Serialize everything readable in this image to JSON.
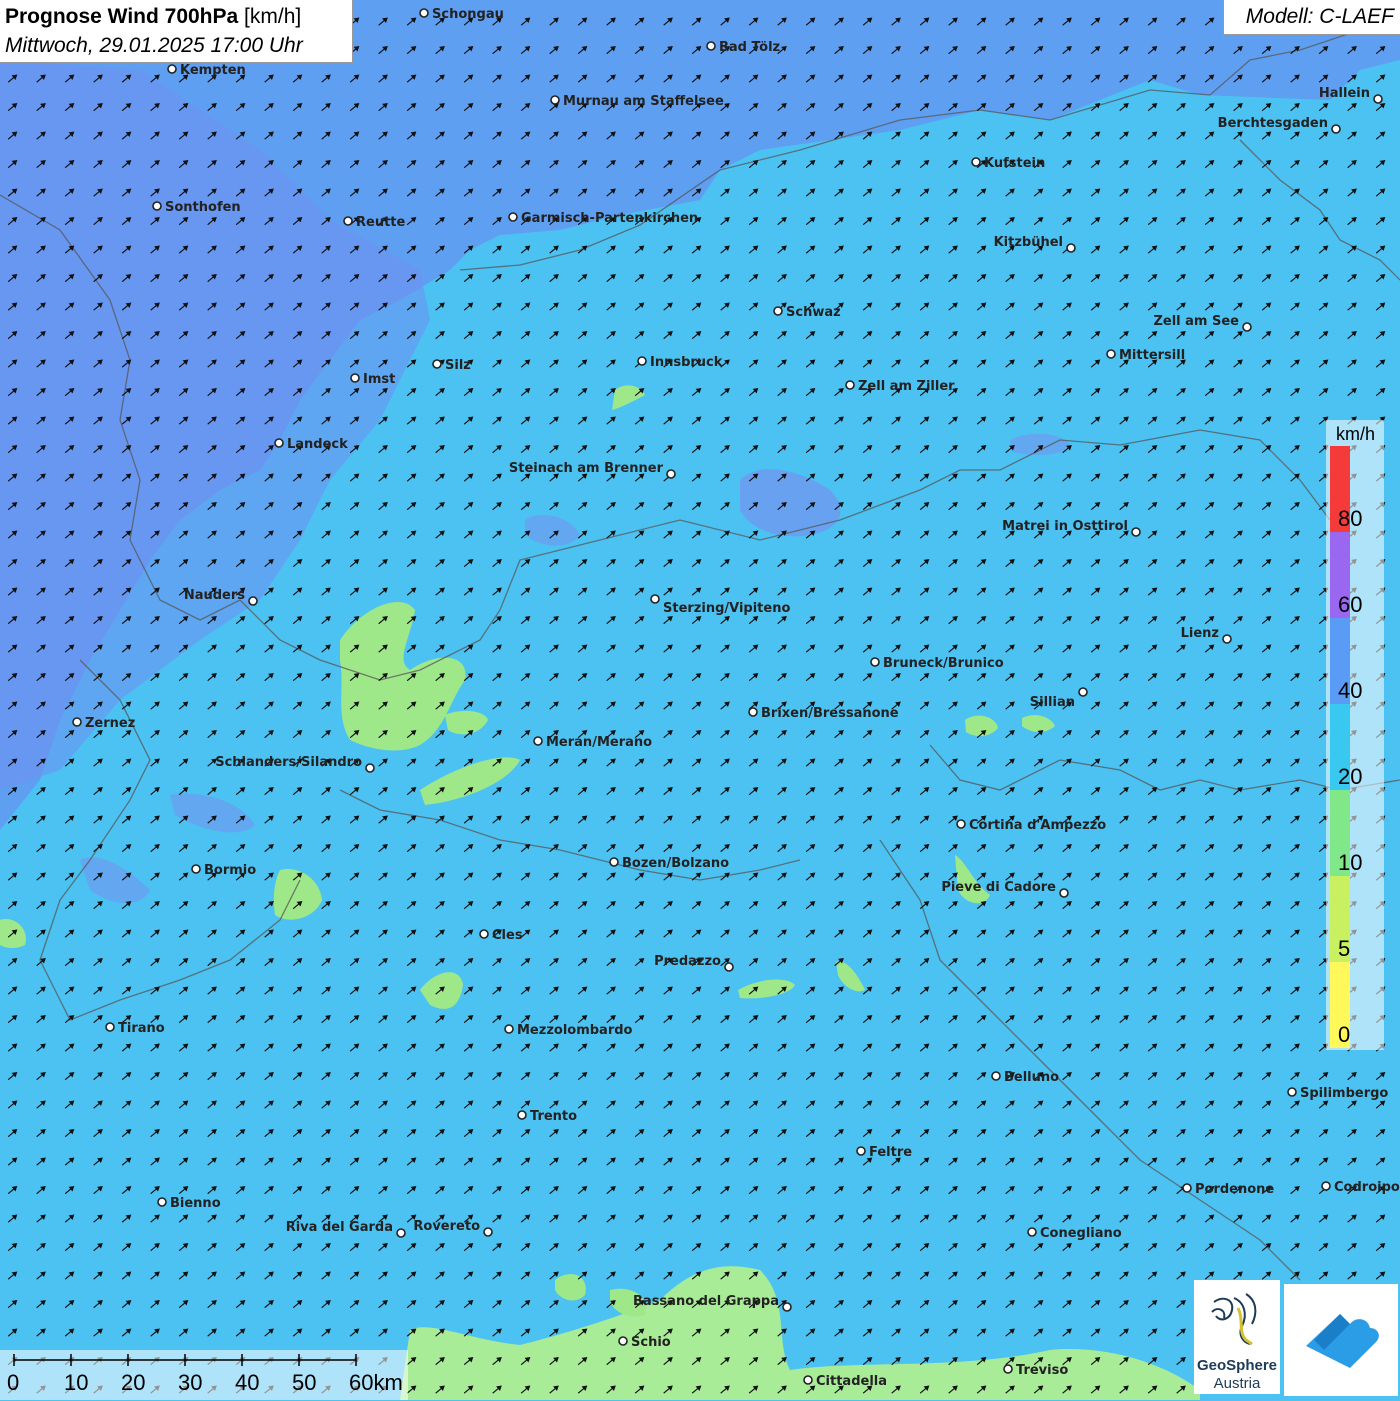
{
  "title": {
    "main": "Prognose Wind 700hPa",
    "unit": "[km/h]",
    "datetime": "Mittwoch, 29.01.2025 17:00 Uhr"
  },
  "model": "Modell: C-LAEF",
  "legend": {
    "unit": "km/h",
    "steps": [
      {
        "label": "0",
        "color": "#fff85a"
      },
      {
        "label": "5",
        "color": "#c8f060"
      },
      {
        "label": "10",
        "color": "#80e888"
      },
      {
        "label": "20",
        "color": "#38c8f0"
      },
      {
        "label": "40",
        "color": "#5a9cf5"
      },
      {
        "label": "60",
        "color": "#9a68f0"
      },
      {
        "label": "80",
        "color": "#f53a3a"
      }
    ]
  },
  "scale": {
    "labels": [
      "0",
      "10",
      "20",
      "30",
      "40",
      "50",
      "60km"
    ]
  },
  "cities": [
    {
      "name": "Schongau"
    },
    {
      "name": "Bad Tölz"
    },
    {
      "name": "Kempten"
    },
    {
      "name": "Murnau am Staffelsee"
    },
    {
      "name": "Hallein"
    },
    {
      "name": "Berchtesgaden"
    },
    {
      "name": "Kufstein"
    },
    {
      "name": "Sonthofen"
    },
    {
      "name": "Reutte"
    },
    {
      "name": "Garmisch-Partenkirchen"
    },
    {
      "name": "Kitzbühel"
    },
    {
      "name": "Schwaz"
    },
    {
      "name": "Zell am See"
    },
    {
      "name": "Mittersill"
    },
    {
      "name": "Silz"
    },
    {
      "name": "Innsbruck"
    },
    {
      "name": "Imst"
    },
    {
      "name": "Zell am Ziller"
    },
    {
      "name": "Landeck"
    },
    {
      "name": "Steinach am Brenner"
    },
    {
      "name": "Matrei in Osttirol"
    },
    {
      "name": "Nauders"
    },
    {
      "name": "Sterzing/Vipiteno"
    },
    {
      "name": "Lienz"
    },
    {
      "name": "Bruneck/Brunico"
    },
    {
      "name": "Sillian"
    },
    {
      "name": "Zernez"
    },
    {
      "name": "Brixen/Bressanone"
    },
    {
      "name": "Meran/Merano"
    },
    {
      "name": "Schlanders/Silandro"
    },
    {
      "name": "Cortina d'Ampezzo"
    },
    {
      "name": "Bozen/Bolzano"
    },
    {
      "name": "Bormio"
    },
    {
      "name": "Pieve di Cadore"
    },
    {
      "name": "Cles"
    },
    {
      "name": "Predazzo"
    },
    {
      "name": "Tirano"
    },
    {
      "name": "Mezzolombardo"
    },
    {
      "name": "Belluno"
    },
    {
      "name": "Spilimbergo"
    },
    {
      "name": "Trento"
    },
    {
      "name": "Feltre"
    },
    {
      "name": "Pordenone"
    },
    {
      "name": "Codroipo"
    },
    {
      "name": "Bienno"
    },
    {
      "name": "Riva del Garda"
    },
    {
      "name": "Rovereto"
    },
    {
      "name": "Conegliano"
    },
    {
      "name": "Bassano del Grappa"
    },
    {
      "name": "Schio"
    },
    {
      "name": "Treviso"
    },
    {
      "name": "Cittadella"
    }
  ],
  "logos": {
    "geosphere_line1": "GeoSphere",
    "geosphere_line2": "Austria"
  }
}
